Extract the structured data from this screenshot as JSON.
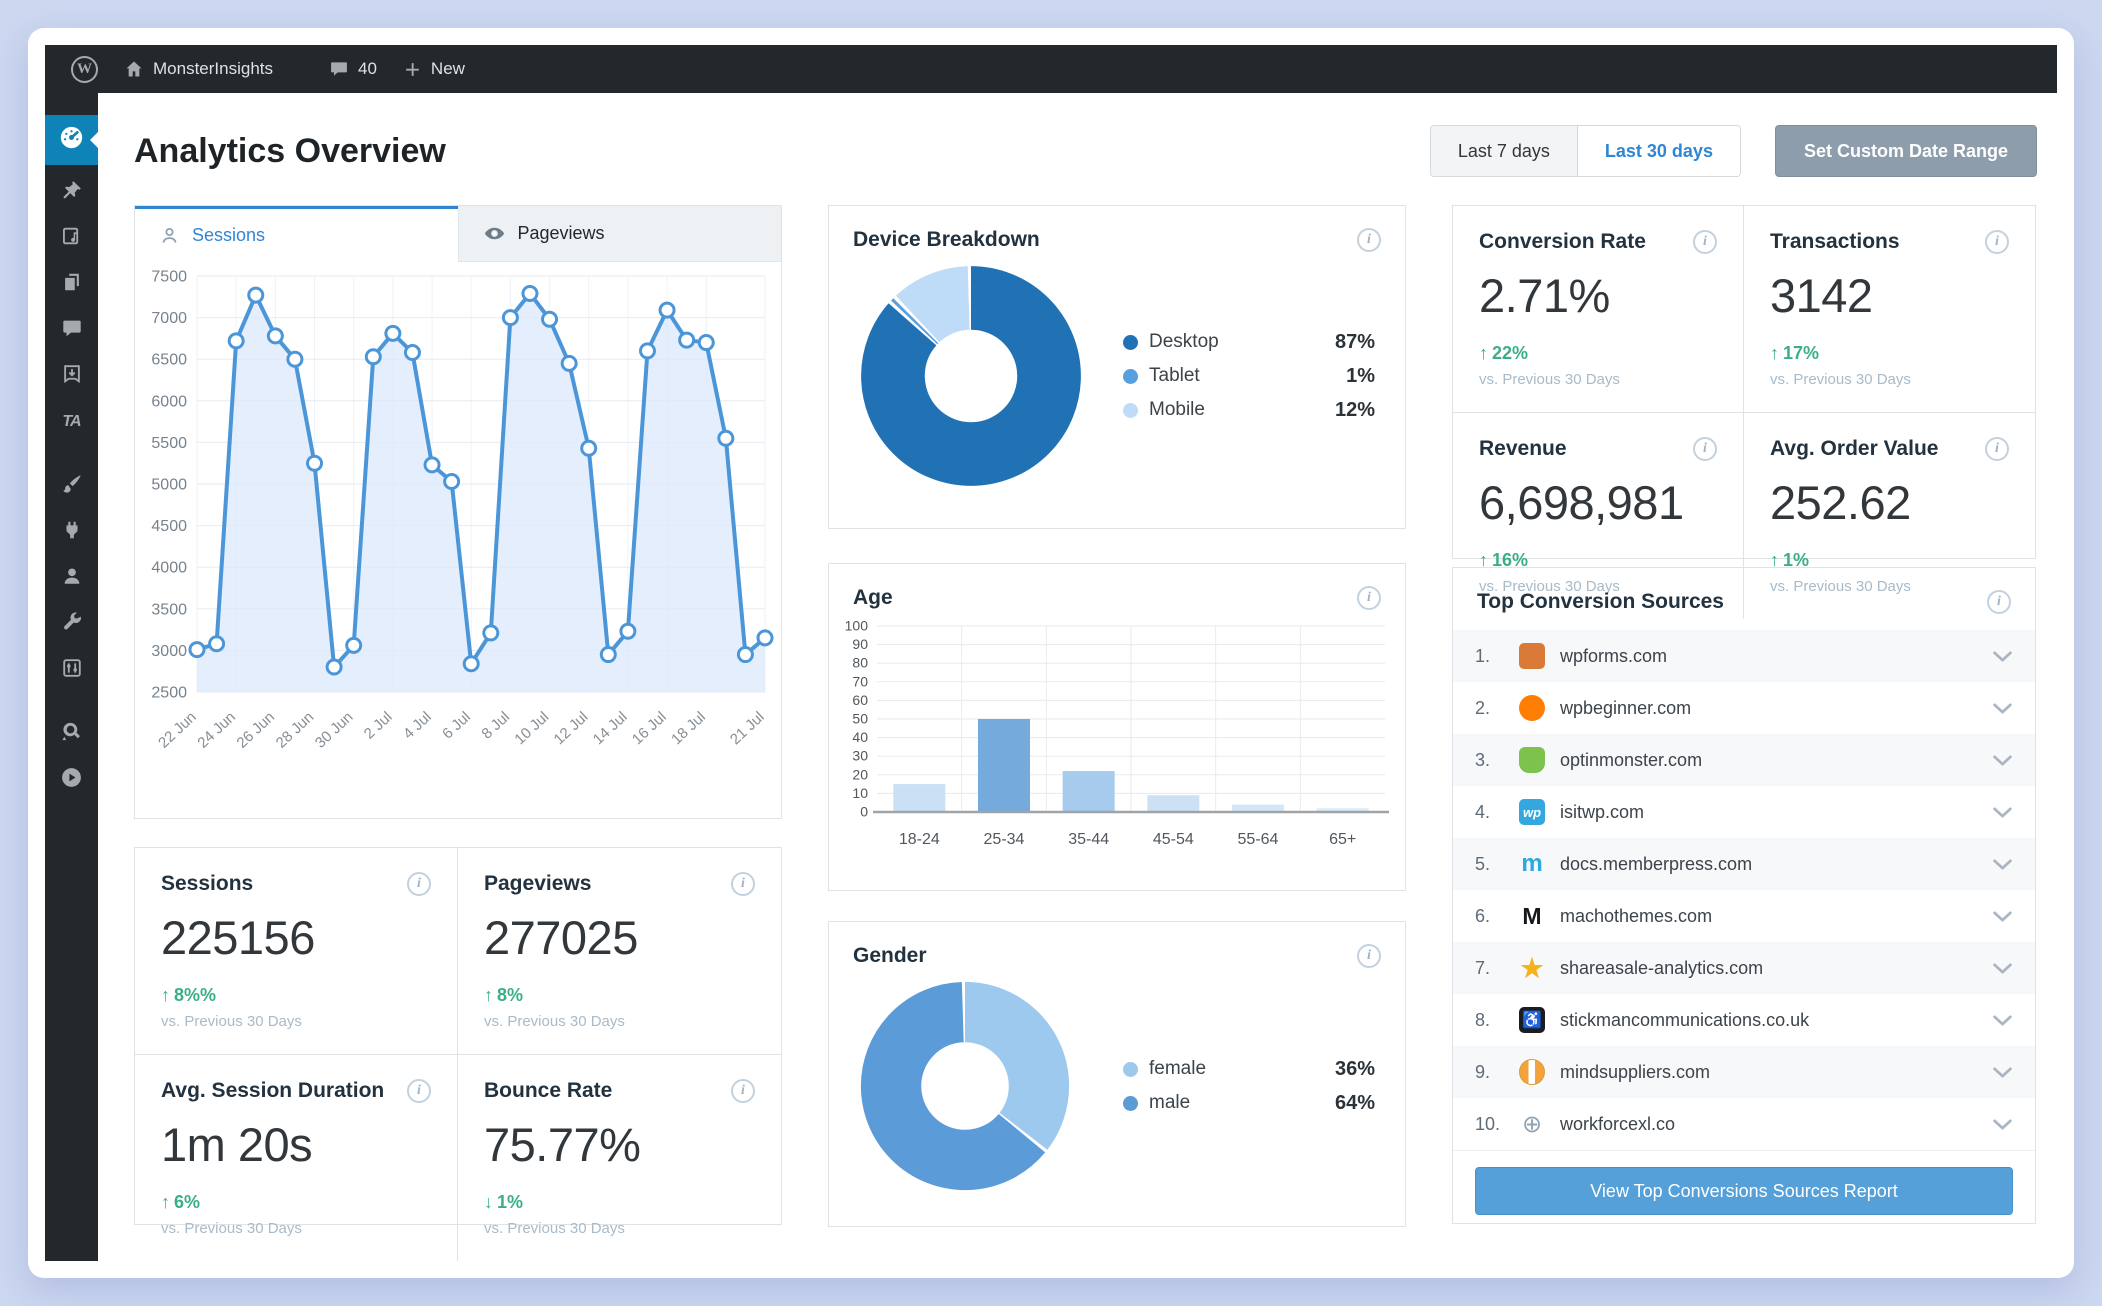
{
  "colors": {
    "accent_blue": "#2f86d3",
    "active_menu_blue": "#0e83b8",
    "green_up": "#3aaf85",
    "chart_line_blue": "#4b96d8",
    "custom_range_gray": "#8d9dab"
  },
  "admin_bar": {
    "site": "MonsterInsights",
    "comments_count": "40",
    "new_label": "New"
  },
  "sidebar": {
    "items": [
      {
        "name": "dashboard",
        "active": true
      },
      {
        "name": "pin",
        "active": false
      },
      {
        "name": "media",
        "active": false
      },
      {
        "name": "pages",
        "active": false
      },
      {
        "name": "comments",
        "active": false
      },
      {
        "name": "downloads",
        "active": false
      },
      {
        "name": "ta",
        "active": false
      },
      {
        "name": "appearance",
        "active": false
      },
      {
        "name": "plugins",
        "active": false
      },
      {
        "name": "users",
        "active": false
      },
      {
        "name": "tools",
        "active": false
      },
      {
        "name": "settings",
        "active": false
      },
      {
        "name": "seo",
        "active": false
      },
      {
        "name": "video",
        "active": false
      }
    ]
  },
  "header": {
    "title": "Analytics Overview",
    "range_7_label": "Last 7 days",
    "range_30_label": "Last 30 days",
    "custom_range_label": "Set Custom Date Range"
  },
  "tabs": {
    "sessions_label": "Sessions",
    "pageviews_label": "Pageviews"
  },
  "chart_data": [
    {
      "type": "line",
      "title": "Sessions",
      "x": [
        "22 Jun",
        "23 Jun",
        "24 Jun",
        "25 Jun",
        "26 Jun",
        "27 Jun",
        "28 Jun",
        "29 Jun",
        "30 Jun",
        "1 Jul",
        "2 Jul",
        "3 Jul",
        "4 Jul",
        "5 Jul",
        "6 Jul",
        "7 Jul",
        "8 Jul",
        "9 Jul",
        "10 Jul",
        "11 Jul",
        "12 Jul",
        "13 Jul",
        "14 Jul",
        "15 Jul",
        "16 Jul",
        "17 Jul",
        "18 Jul",
        "19 Jul",
        "20 Jul",
        "21 Jul"
      ],
      "values": [
        3010,
        3080,
        6720,
        7270,
        6780,
        6500,
        5250,
        2800,
        3060,
        6530,
        6810,
        6580,
        5230,
        5030,
        2840,
        3210,
        7000,
        7290,
        6980,
        6450,
        5430,
        2950,
        3230,
        6600,
        7090,
        6730,
        6700,
        5550,
        2950,
        3150
      ],
      "tick_indices": [
        0,
        2,
        4,
        6,
        8,
        10,
        12,
        14,
        16,
        18,
        20,
        22,
        24,
        26,
        29
      ],
      "ylim": [
        2500,
        7500
      ],
      "ytick_step": 500,
      "grid": true,
      "legend_position": "none"
    },
    {
      "type": "pie",
      "title": "Device Breakdown",
      "labels": [
        "Desktop",
        "Tablet",
        "Mobile"
      ],
      "values": [
        87,
        1,
        12
      ],
      "colors": [
        "#2171b5",
        "#56a0e0",
        "#bedcf8"
      ],
      "legend_position": "right"
    },
    {
      "type": "bar",
      "title": "Age",
      "categories": [
        "18-24",
        "25-34",
        "35-44",
        "45-54",
        "55-64",
        "65+"
      ],
      "values": [
        15,
        50,
        22,
        9,
        4,
        2
      ],
      "colors": [
        "#c9e0f5",
        "#74aadc",
        "#a6cbec",
        "#cce1f4",
        "#d5e7f7",
        "#dcecf9"
      ],
      "ylim": [
        0,
        100
      ],
      "ytick_step": 10,
      "grid": true,
      "legend_position": "none"
    },
    {
      "type": "pie",
      "title": "Gender",
      "labels": [
        "female",
        "male"
      ],
      "values": [
        36,
        64
      ],
      "colors": [
        "#9ec9ef",
        "#5b9bd8"
      ],
      "legend_position": "right"
    }
  ],
  "kpis": [
    {
      "label": "Conversion Rate",
      "value": "2.71%",
      "change": "22%",
      "direction": "up",
      "note": "vs. Previous 30 Days"
    },
    {
      "label": "Transactions",
      "value": "3142",
      "change": "17%",
      "direction": "up",
      "note": "vs. Previous 30 Days"
    },
    {
      "label": "Revenue",
      "value": "6,698,981",
      "change": "16%",
      "direction": "up",
      "note": "vs. Previous 30 Days"
    },
    {
      "label": "Avg. Order Value",
      "value": "252.62",
      "change": "1%",
      "direction": "up",
      "note": "vs. Previous 30 Days"
    }
  ],
  "stats": [
    {
      "label": "Sessions",
      "value": "225156",
      "change": "8%%",
      "direction": "up",
      "note": "vs. Previous 30 Days"
    },
    {
      "label": "Pageviews",
      "value": "277025",
      "change": "8%",
      "direction": "up",
      "note": "vs. Previous 30 Days"
    },
    {
      "label": "Avg. Session Duration",
      "value": "1m 20s",
      "change": "6%",
      "direction": "up",
      "note": "vs. Previous 30 Days"
    },
    {
      "label": "Bounce Rate",
      "value": "75.77%",
      "change": "1%",
      "direction": "down",
      "note": "vs. Previous 30 Days"
    }
  ],
  "sources": {
    "title": "Top Conversion Sources",
    "button_label": "View Top Conversions Sources Report",
    "items": [
      {
        "rank": "1.",
        "domain": "wpforms.com",
        "icon": "wpforms",
        "glyph": ""
      },
      {
        "rank": "2.",
        "domain": "wpbeginner.com",
        "icon": "wpbeginner",
        "glyph": ""
      },
      {
        "rank": "3.",
        "domain": "optinmonster.com",
        "icon": "optinmonster",
        "glyph": ""
      },
      {
        "rank": "4.",
        "domain": "isitwp.com",
        "icon": "isitwp",
        "glyph": "wp"
      },
      {
        "rank": "5.",
        "domain": "docs.memberpress.com",
        "icon": "memberpress",
        "glyph": "m"
      },
      {
        "rank": "6.",
        "domain": "machothemes.com",
        "icon": "machothemes",
        "glyph": "M"
      },
      {
        "rank": "7.",
        "domain": "shareasale-analytics.com",
        "icon": "shareasale",
        "glyph": "★"
      },
      {
        "rank": "8.",
        "domain": "stickmancommunications.co.uk",
        "icon": "stickman",
        "glyph": "♿"
      },
      {
        "rank": "9.",
        "domain": "mindsuppliers.com",
        "icon": "mindsuppliers",
        "glyph": ""
      },
      {
        "rank": "10.",
        "domain": "workforcexl.co",
        "icon": "workforcexl",
        "glyph": "⊕"
      }
    ]
  }
}
